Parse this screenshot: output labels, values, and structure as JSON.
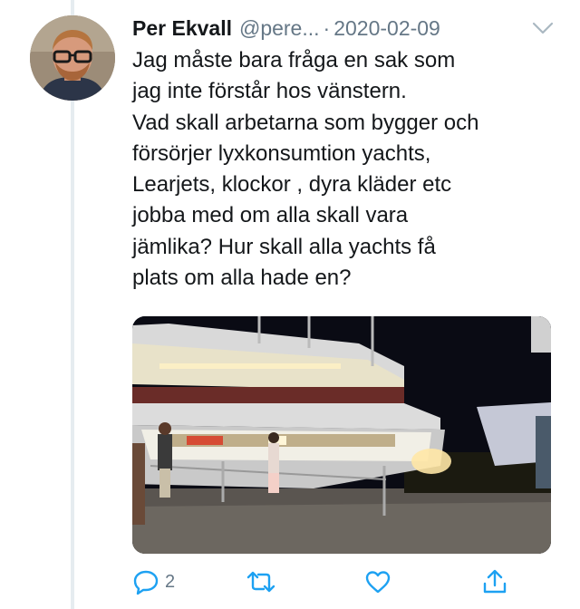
{
  "tweet": {
    "display_name": "Per Ekvall",
    "handle": "@pere...",
    "separator": "·",
    "date": "2020-02-09",
    "text": "Jag måste bara fråga en sak som\njag inte förstår hos vänstern.\nVad skall arbetarna som bygger och\nförsörjer lyxkonsumtion yachts,\nLearjets, klockor , dyra kläder etc\njobba med om alla skall vara\njämlika? Hur skall alla yachts få\nplats om alla hade en?",
    "reply_count": "2"
  },
  "icons": {
    "more": "chevron-down-icon",
    "reply": "reply-icon",
    "retweet": "retweet-icon",
    "like": "heart-icon",
    "share": "share-icon"
  },
  "colors": {
    "text": "#14171a",
    "secondary": "#657786",
    "icon": "#1da1f2",
    "thread_line": "#e6ecf0"
  }
}
